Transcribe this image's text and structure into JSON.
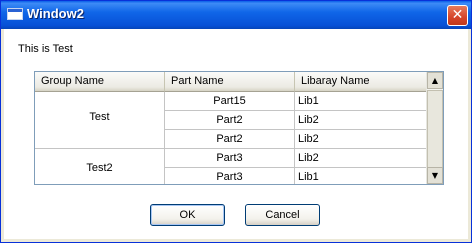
{
  "window": {
    "title": "Window2",
    "close_glyph": "✕"
  },
  "message": "This is Test",
  "grid": {
    "headers": [
      "Group Name",
      "Part Name",
      "Libaray Name"
    ],
    "groups": [
      "Test",
      "Test2"
    ],
    "rows": [
      {
        "part": "Part15",
        "lib": "Lib1"
      },
      {
        "part": "Part2",
        "lib": "Lib2"
      },
      {
        "part": "Part2",
        "lib": "Lib2"
      },
      {
        "part": "Part3",
        "lib": "Lib2"
      },
      {
        "part": "Part3",
        "lib": "Lib1"
      }
    ],
    "scroll_up_glyph": "▲",
    "scroll_down_glyph": "▼"
  },
  "buttons": {
    "ok": "OK",
    "cancel": "Cancel"
  }
}
